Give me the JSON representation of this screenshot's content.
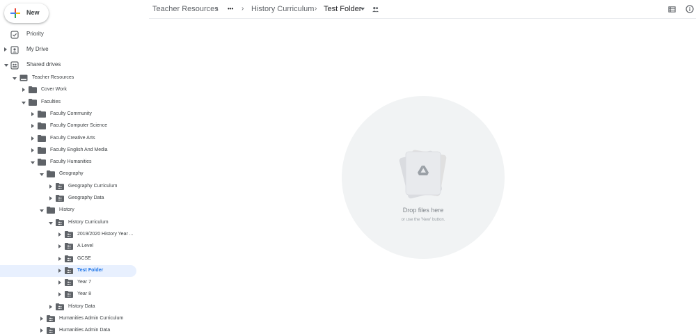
{
  "new_button": {
    "label": "New"
  },
  "nav": {
    "priority": "Priority",
    "my_drive": "My Drive",
    "shared_drives": "Shared drives"
  },
  "tree": [
    {
      "label": "Teacher Resources",
      "icon": "shared-drive-icon",
      "state": "expanded"
    },
    {
      "label": "Cover Work",
      "icon": "folder-icon",
      "state": "collapsed"
    },
    {
      "label": "Faculties",
      "icon": "folder-icon",
      "state": "expanded"
    },
    {
      "label": "Faculty Community",
      "icon": "folder-icon",
      "state": "collapsed"
    },
    {
      "label": "Faculty Computer Science",
      "icon": "folder-icon",
      "state": "collapsed"
    },
    {
      "label": "Faculty Creative Arts",
      "icon": "folder-icon",
      "state": "collapsed"
    },
    {
      "label": "Faculty English And Media",
      "icon": "folder-icon",
      "state": "collapsed"
    },
    {
      "label": "Faculty Humanities",
      "icon": "folder-icon",
      "state": "expanded"
    },
    {
      "label": "Geography",
      "icon": "folder-icon",
      "state": "expanded"
    },
    {
      "label": "Geography Curriculum",
      "icon": "shared-folder-icon",
      "state": "collapsed"
    },
    {
      "label": "Geography Data",
      "icon": "shared-folder-icon",
      "state": "collapsed"
    },
    {
      "label": "History",
      "icon": "folder-icon",
      "state": "expanded"
    },
    {
      "label": "History Curriculum",
      "icon": "shared-folder-icon",
      "state": "expanded"
    },
    {
      "label": "2019/2020 History Year ...",
      "icon": "shared-folder-icon",
      "state": "collapsed"
    },
    {
      "label": "A Level",
      "icon": "shared-folder-icon",
      "state": "collapsed"
    },
    {
      "label": "GCSE",
      "icon": "shared-folder-icon",
      "state": "collapsed"
    },
    {
      "label": "Test Folder",
      "icon": "shared-folder-icon",
      "state": "collapsed",
      "selected": true
    },
    {
      "label": "Year 7",
      "icon": "shared-folder-icon",
      "state": "collapsed"
    },
    {
      "label": "Year 8",
      "icon": "shared-folder-icon",
      "state": "collapsed"
    },
    {
      "label": "History Data",
      "icon": "shared-folder-icon",
      "state": "collapsed"
    },
    {
      "label": "Humanities Admin Curriculum",
      "icon": "shared-folder-icon",
      "state": "collapsed"
    },
    {
      "label": "Humanities Admin Data",
      "icon": "shared-folder-icon",
      "state": "collapsed"
    }
  ],
  "breadcrumb": {
    "root": "Teacher Resources",
    "ellipsis": "•••",
    "parent": "History Curriculum",
    "current": "Test Folder",
    "separator": "›"
  },
  "header_icons": [
    "list-view-icon",
    "info-icon"
  ],
  "empty_state": {
    "title": "Drop files here",
    "subtitle": "or use the 'New' button."
  },
  "colors": {
    "accent": "#1a73e8",
    "selected_bg": "#e8f0fe",
    "drop_circle": "#f1f3f4",
    "icon_gray": "#5f6368"
  }
}
